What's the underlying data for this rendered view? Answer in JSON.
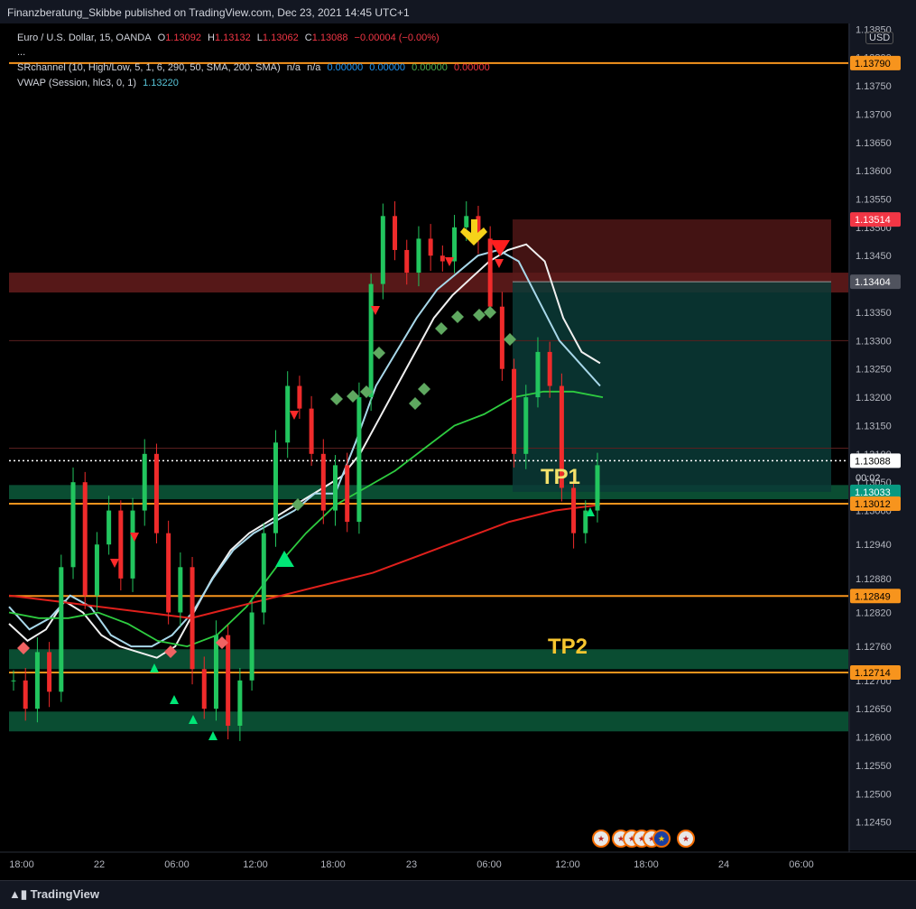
{
  "header": {
    "publish_line": "Finanzberatung_Skibbe published on TradingView.com, Dec 23, 2021 14:45 UTC+1"
  },
  "legend": {
    "symbol": "Euro / U.S. Dollar, 15, OANDA",
    "ohlc": {
      "o_label": "O",
      "o": "1.13092",
      "h_label": "H",
      "h": "1.13132",
      "l_label": "L",
      "l": "1.13062",
      "c_label": "C",
      "c": "1.13088",
      "change": "−0.00004 (−0.00%)"
    },
    "more": "...",
    "srchannel": {
      "label": "SRchannel (10, High/Low, 5, 1, 6, 290, 50, SMA, 200, SMA)",
      "na1": "n/a",
      "na2": "n/a",
      "v1": "0.00000",
      "v2": "0.00000",
      "v3": "0.00000",
      "v4": "0.00000"
    },
    "vwap": {
      "label": "VWAP (Session, hlc3, 0, 1)",
      "value": "1.13220"
    }
  },
  "axis": {
    "currency": "USD",
    "countdown": "00:02"
  },
  "annotations": {
    "tp1": "TP1",
    "tp2": "TP2"
  },
  "footer": {
    "brand": "TradingView"
  },
  "colors": {
    "background": "#131722",
    "up": "#22c55e",
    "down": "#ef2b2b",
    "orange": "#f7941d",
    "teal": "#089981",
    "sma_white": "#f0f0f0",
    "vwap": "#a8d8ea",
    "sma_green": "#2ecc40",
    "sma_red": "#e0201c"
  },
  "chart_data": {
    "type": "candlestick",
    "title": "",
    "xlabel": "",
    "ylabel": "",
    "ylim": [
      1.124,
      1.1386
    ],
    "x_ticks": [
      "18:00",
      "22",
      "06:00",
      "12:00",
      "18:00",
      "23",
      "06:00",
      "12:00",
      "18:00",
      "24",
      "06:00"
    ],
    "y_ticks": [
      "1.13850",
      "1.13800",
      "1.13750",
      "1.13700",
      "1.13650",
      "1.13600",
      "1.13550",
      "1.13500",
      "1.13450",
      "1.13400",
      "1.13350",
      "1.13300",
      "1.13250",
      "1.13200",
      "1.13150",
      "1.13100",
      "1.13050",
      "1.13000",
      "1.12940",
      "1.12880",
      "1.12820",
      "1.12760",
      "1.12700",
      "1.12650",
      "1.12600",
      "1.12550",
      "1.12500",
      "1.12450"
    ],
    "price_labels": [
      {
        "value": "1.13790",
        "kind": "orange"
      },
      {
        "value": "1.13514",
        "kind": "red"
      },
      {
        "value": "1.13404",
        "kind": "gray"
      },
      {
        "value": "1.13088",
        "kind": "current"
      },
      {
        "value": "1.13033",
        "kind": "teal"
      },
      {
        "value": "1.13012",
        "kind": "orange"
      },
      {
        "value": "1.12849",
        "kind": "orange"
      },
      {
        "value": "1.12714",
        "kind": "orange"
      }
    ],
    "levels": [
      1.1379,
      1.13012,
      1.12849,
      1.12714
    ],
    "resistance_zone": [
      1.13385,
      1.1342
    ],
    "support_zones": [
      [
        1.1302,
        1.13045
      ],
      [
        1.1272,
        1.12755
      ],
      [
        1.1261,
        1.12645
      ]
    ],
    "series": [
      {
        "name": "close",
        "values": [
          1.127,
          1.1265,
          1.1275,
          1.1268,
          1.129,
          1.1305,
          1.1285,
          1.1294,
          1.13,
          1.1288,
          1.13,
          1.131,
          1.1296,
          1.1282,
          1.129,
          1.1272,
          1.1265,
          1.1278,
          1.1262,
          1.127,
          1.1282,
          1.1296,
          1.1312,
          1.1322,
          1.1318,
          1.131,
          1.13,
          1.1308,
          1.1298,
          1.132,
          1.134,
          1.1352,
          1.1346,
          1.1342,
          1.1348,
          1.1345,
          1.1344,
          1.135,
          1.1352,
          1.1348,
          1.1336,
          1.1325,
          1.131,
          1.132,
          1.1328,
          1.1322,
          1.1304,
          1.1296,
          1.13,
          1.1308
        ]
      },
      {
        "name": "sma_white",
        "values": [
          1.128,
          1.1277,
          1.1279,
          1.1284,
          1.1282,
          1.1278,
          1.1276,
          1.1275,
          1.1274,
          1.1276,
          1.1282,
          1.1288,
          1.1293,
          1.1296,
          1.1298,
          1.13,
          1.1302,
          1.1304,
          1.1306,
          1.131,
          1.1316,
          1.1322,
          1.1328,
          1.1334,
          1.1338,
          1.1341,
          1.1344,
          1.1346,
          1.1347,
          1.1344,
          1.1334,
          1.1328,
          1.1326
        ]
      },
      {
        "name": "vwap",
        "values": [
          1.1283,
          1.1279,
          1.1281,
          1.1285,
          1.1283,
          1.1278,
          1.1276,
          1.1276,
          1.1278,
          1.1282,
          1.1288,
          1.1293,
          1.1296,
          1.1298,
          1.13,
          1.1303,
          1.1303,
          1.1312,
          1.1322,
          1.1328,
          1.1334,
          1.1339,
          1.1342,
          1.1345,
          1.1346,
          1.1344,
          1.1337,
          1.133,
          1.1326,
          1.1322
        ]
      },
      {
        "name": "sma_green",
        "values": [
          1.1282,
          1.1281,
          1.1281,
          1.1282,
          1.128,
          1.1277,
          1.1276,
          1.1278,
          1.1283,
          1.129,
          1.1296,
          1.1301,
          1.1304,
          1.1307,
          1.1311,
          1.1315,
          1.1317,
          1.132,
          1.1321,
          1.1321,
          1.132
        ]
      },
      {
        "name": "sma_red",
        "values": [
          1.1285,
          1.1284,
          1.1283,
          1.1282,
          1.1281,
          1.1283,
          1.1285,
          1.1287,
          1.1289,
          1.1292,
          1.1295,
          1.1298,
          1.13,
          1.1301
        ]
      }
    ]
  }
}
